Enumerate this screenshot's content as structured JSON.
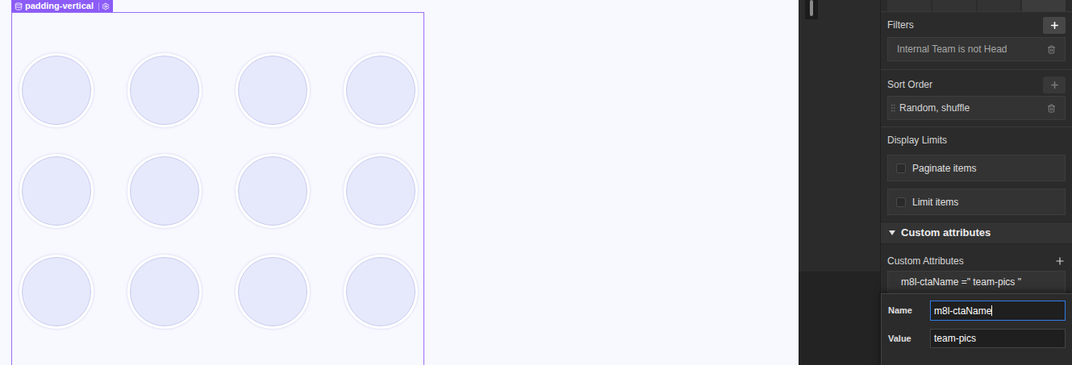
{
  "canvas": {
    "element_label": "padding-vertical",
    "avatars": [
      {
        "kind": "picture"
      },
      {
        "kind": "picture"
      },
      {
        "kind": "picture"
      },
      {
        "kind": "picture"
      },
      {
        "kind": "picture"
      },
      {
        "kind": "picture"
      },
      {
        "kind": "picture"
      },
      {
        "kind": "picture"
      },
      {
        "kind": "picture"
      },
      {
        "kind": "picture"
      },
      {
        "kind": "picture"
      },
      {
        "kind": "picture"
      }
    ]
  },
  "panel": {
    "filters": {
      "label": "Filters",
      "items": [
        "Internal Team is not Head"
      ]
    },
    "sort_order": {
      "label": "Sort Order",
      "items": [
        "Random, shuffle"
      ]
    },
    "display_limits": {
      "label": "Display Limits",
      "options": [
        {
          "label": "Paginate items",
          "checked": false
        },
        {
          "label": "Limit items",
          "checked": false
        }
      ]
    },
    "custom_attributes_section": {
      "label": "Custom attributes",
      "expanded": true
    },
    "custom_attributes": {
      "label": "Custom Attributes",
      "items": [
        "m8l-ctaName =\" team-pics \""
      ]
    },
    "editor": {
      "name_label": "Name",
      "name_value": "m8l-ctaName",
      "name_focused": true,
      "value_label": "Value",
      "value_value": "team-pics"
    }
  }
}
